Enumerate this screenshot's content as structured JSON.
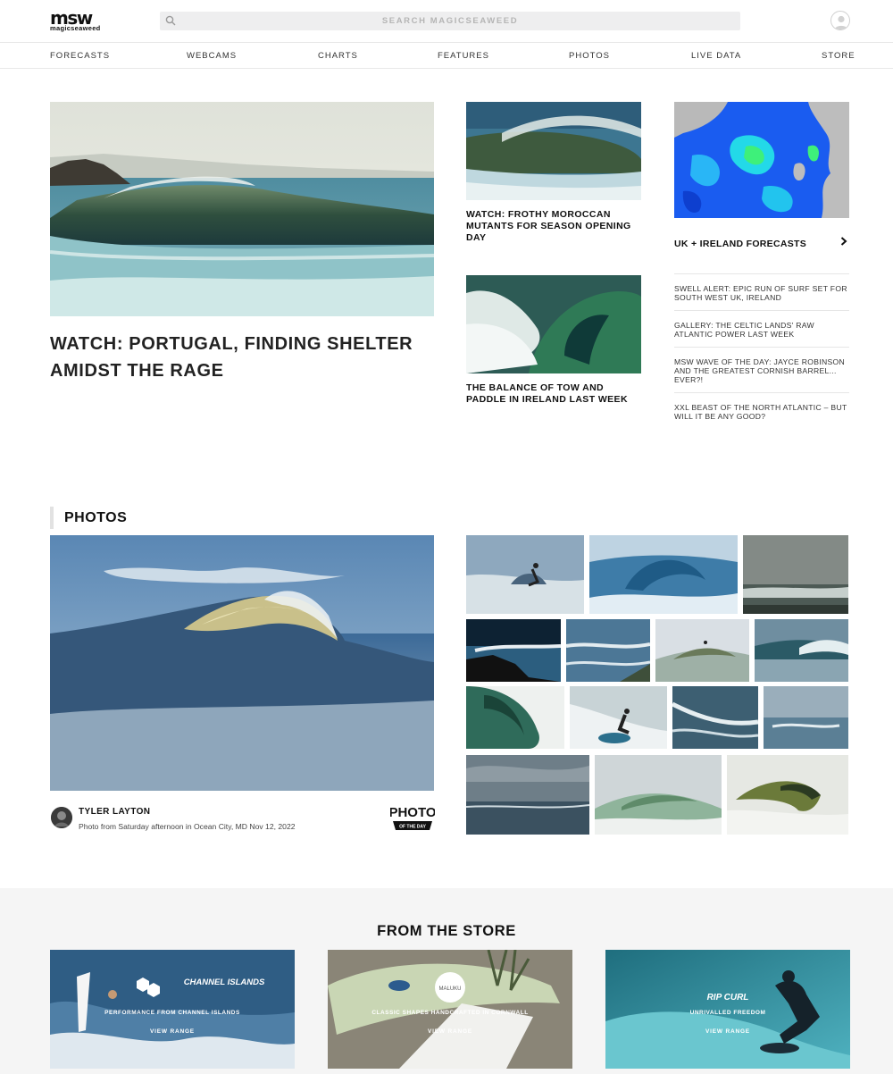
{
  "header": {
    "logo_mark": "msw",
    "logo_sub": "magicseaweed",
    "search_placeholder": "SEARCH MAGICSEAWEED"
  },
  "nav": {
    "items": [
      "FORECASTS",
      "WEBCAMS",
      "CHARTS",
      "FEATURES",
      "PHOTOS",
      "LIVE DATA",
      "STORE"
    ]
  },
  "hero": {
    "title": "WATCH: PORTUGAL, FINDING SHELTER AMIDST THE RAGE"
  },
  "cards": [
    {
      "title": "WATCH: FROTHY MOROCCAN MUTANTS FOR SEASON OPENING DAY"
    },
    {
      "title": "THE BALANCE OF TOW AND PADDLE IN IRELAND LAST WEEK"
    }
  ],
  "forecast": {
    "label": "UK + IRELAND FORECASTS"
  },
  "news": [
    "SWELL ALERT: EPIC RUN OF SURF SET FOR SOUTH WEST UK, IRELAND",
    "GALLERY: THE CELTIC LANDS' RAW ATLANTIC POWER LAST WEEK",
    "MSW WAVE OF THE DAY: JAYCE ROBINSON AND THE GREATEST CORNISH BARREL... EVER?!",
    "XXL BEAST OF THE NORTH ATLANTIC – BUT WILL IT BE ANY GOOD?"
  ],
  "photos": {
    "heading": "PHOTOS",
    "photographer": "TYLER LAYTON",
    "caption": "Photo from Saturday afternoon in Ocean City, MD Nov 12, 2022",
    "badge_top": "PHOTO",
    "badge_bottom": "OF THE DAY"
  },
  "store": {
    "heading": "FROM THE STORE",
    "cards": [
      {
        "brand": "CHANNEL ISLANDS",
        "tagline": "PERFORMANCE FROM CHANNEL ISLANDS",
        "cta": "VIEW RANGE"
      },
      {
        "brand": "MALUKU",
        "tagline": "CLASSIC SHAPES HANDCRAFTED IN CORNWALL",
        "cta": "VIEW RANGE"
      },
      {
        "brand": "RIP CURL",
        "tagline": "UNRIVALLED FREEDOM",
        "cta": "VIEW RANGE"
      }
    ]
  }
}
